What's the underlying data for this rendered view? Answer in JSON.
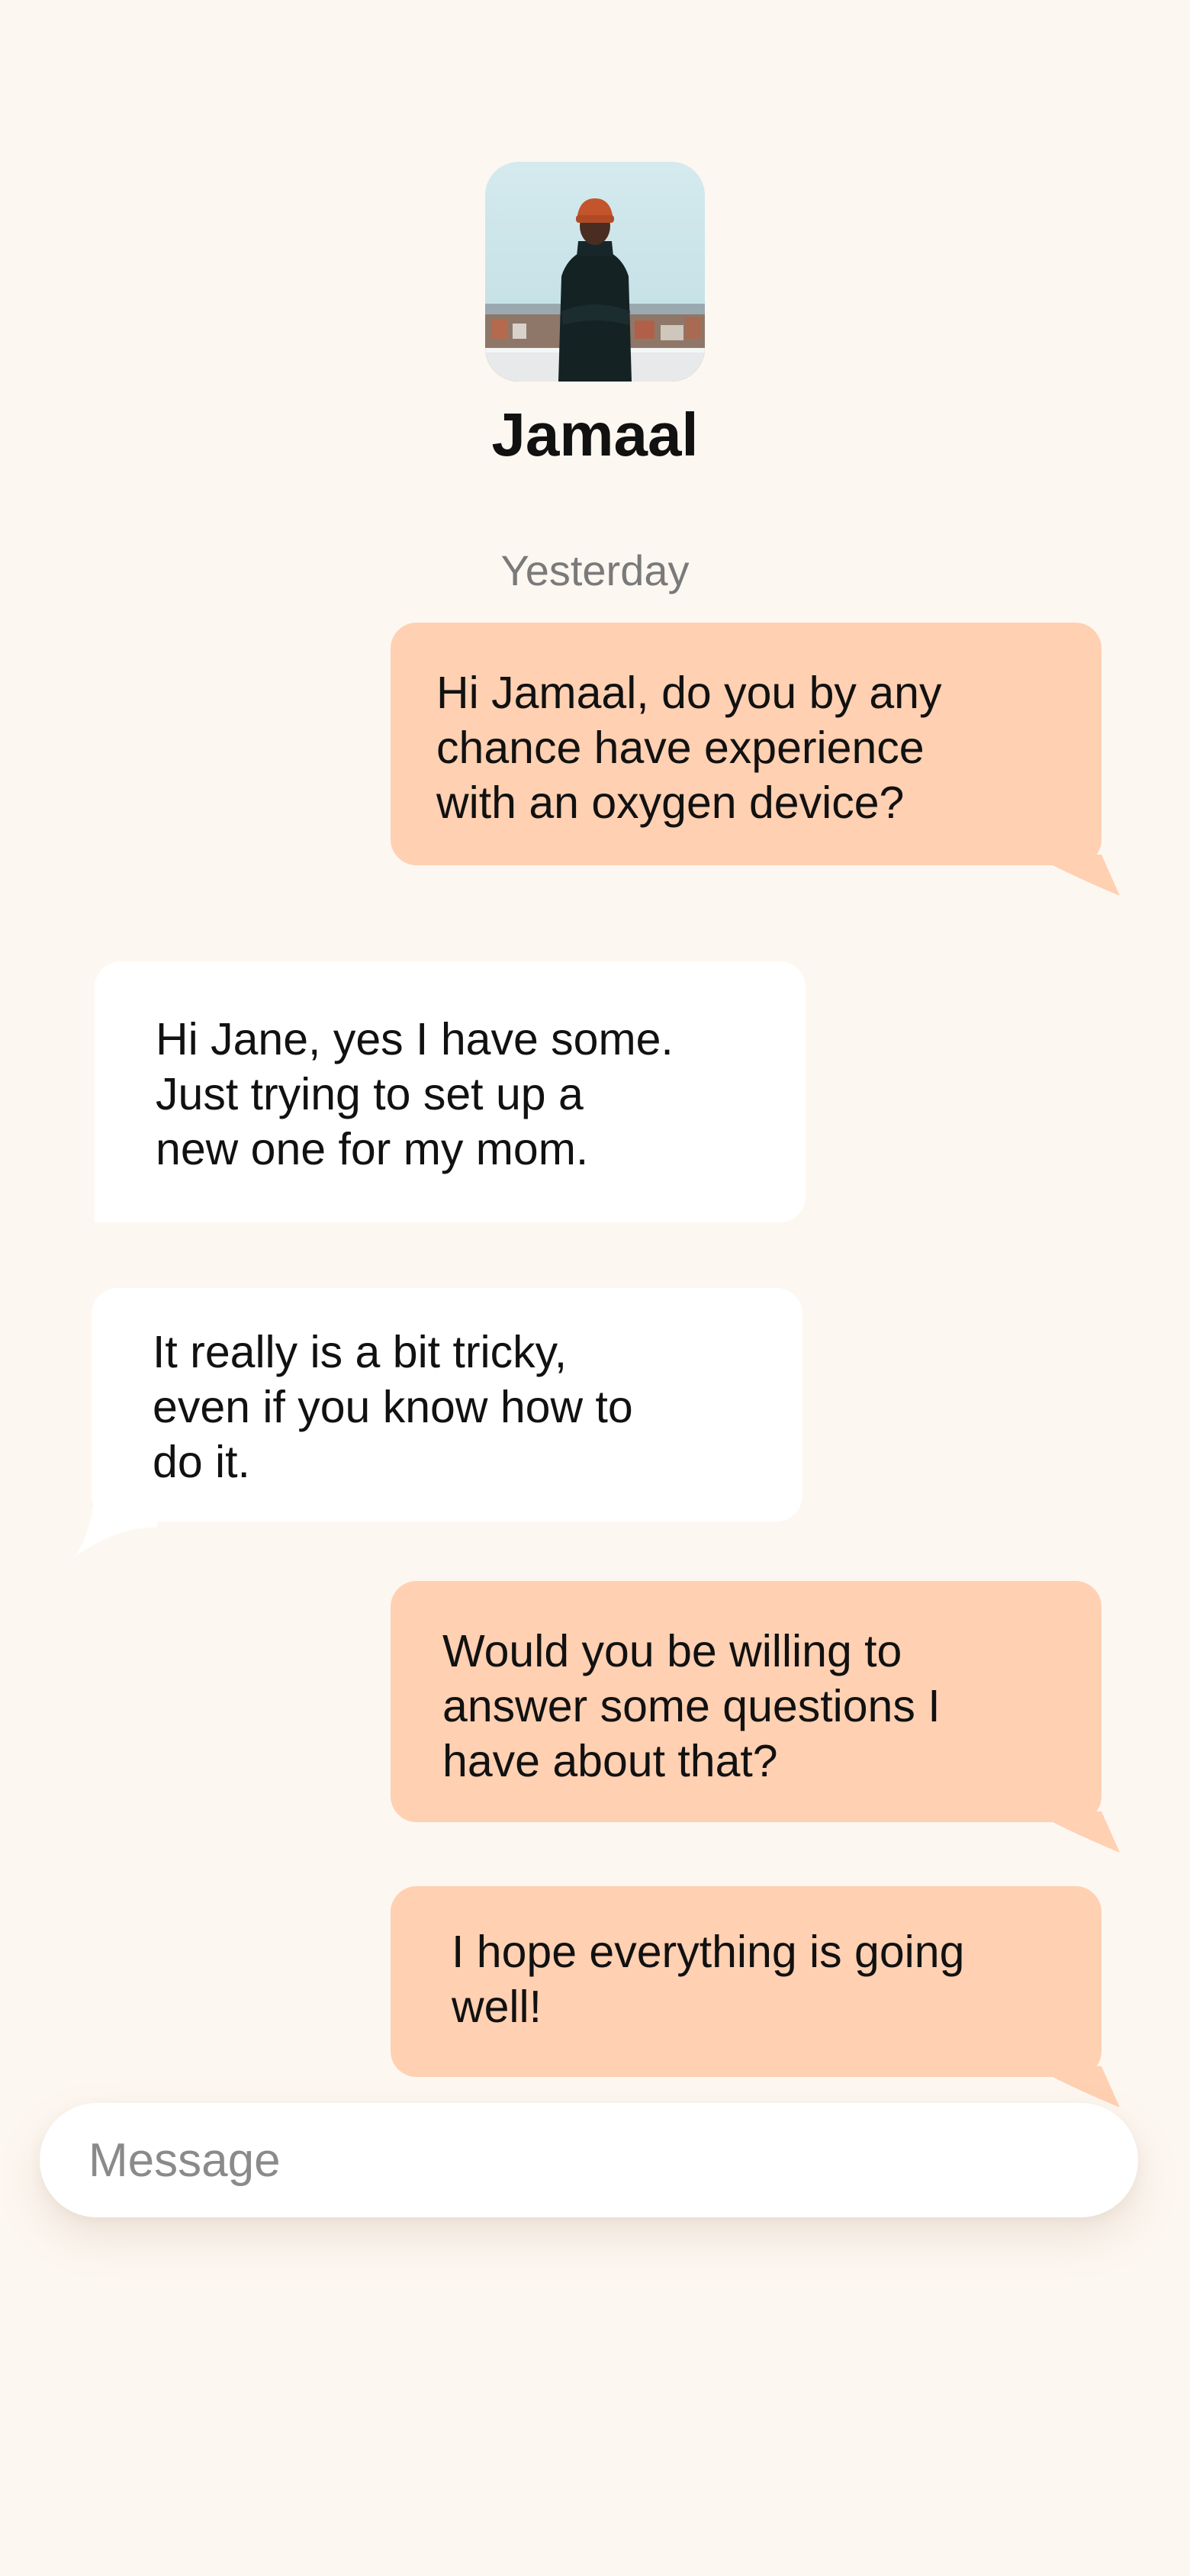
{
  "contact": {
    "name": "Jamaal",
    "avatar_icon": "profile-photo"
  },
  "thread": {
    "date_label": "Yesterday",
    "messages": [
      {
        "direction": "sent",
        "text": "Hi Jamaal, do you by any\nchance have experience\nwith an oxygen device?"
      },
      {
        "direction": "received",
        "text": "Hi Jane, yes I have some.\nJust trying to set up a\nnew one for my mom."
      },
      {
        "direction": "received",
        "text": "It really is a bit tricky,\neven if you know how to\ndo it."
      },
      {
        "direction": "sent",
        "text": "Would you be willing to\nanswer some questions I\nhave about that?"
      },
      {
        "direction": "sent",
        "text": "I hope everything is going\nwell!"
      }
    ]
  },
  "composer": {
    "placeholder": "Message",
    "value": ""
  },
  "colors": {
    "background": "#FDF7F1",
    "sent_bubble": "#FFD0B1",
    "received_bubble": "#FFFFFF",
    "secondary_text": "#7A7A7A"
  }
}
